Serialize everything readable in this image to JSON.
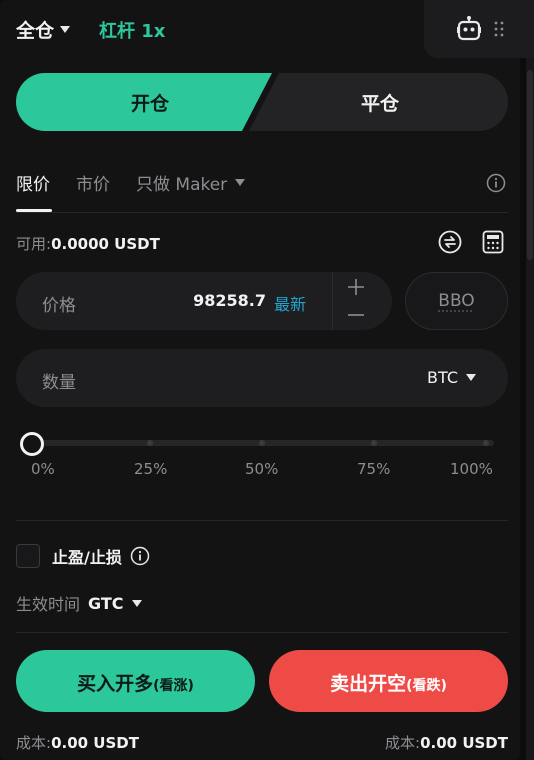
{
  "header": {
    "margin_mode": "全仓",
    "leverage": "杠杆 1x"
  },
  "toggle": {
    "open": "开仓",
    "close": "平仓"
  },
  "order_types": {
    "limit": "限价",
    "market": "市价",
    "maker_only": "只做 Maker"
  },
  "available": {
    "label": "可用:",
    "value": "0.0000 USDT"
  },
  "price": {
    "label": "价格",
    "value": "98258.7",
    "latest": "最新",
    "bbo": "BBO"
  },
  "quantity": {
    "label": "数量",
    "unit": "BTC"
  },
  "slider": {
    "value_percent": 0,
    "labels": [
      "0%",
      "25%",
      "50%",
      "75%",
      "100%"
    ]
  },
  "tpsl": {
    "label": "止盈/止损",
    "checked": false
  },
  "time_in_force": {
    "label": "生效时间",
    "value": "GTC"
  },
  "buttons": {
    "buy_main": "买入开多",
    "buy_sub": "(看涨)",
    "sell_main": "卖出开空",
    "sell_sub": "(看跌)"
  },
  "cost": {
    "buy_label": "成本:",
    "buy_value": "0.00 USDT",
    "sell_label": "成本:",
    "sell_value": "0.00 USDT"
  },
  "colors": {
    "buy": "#2cc79b",
    "sell": "#ef4b46",
    "link": "#22a6cf",
    "background": "#131314"
  }
}
